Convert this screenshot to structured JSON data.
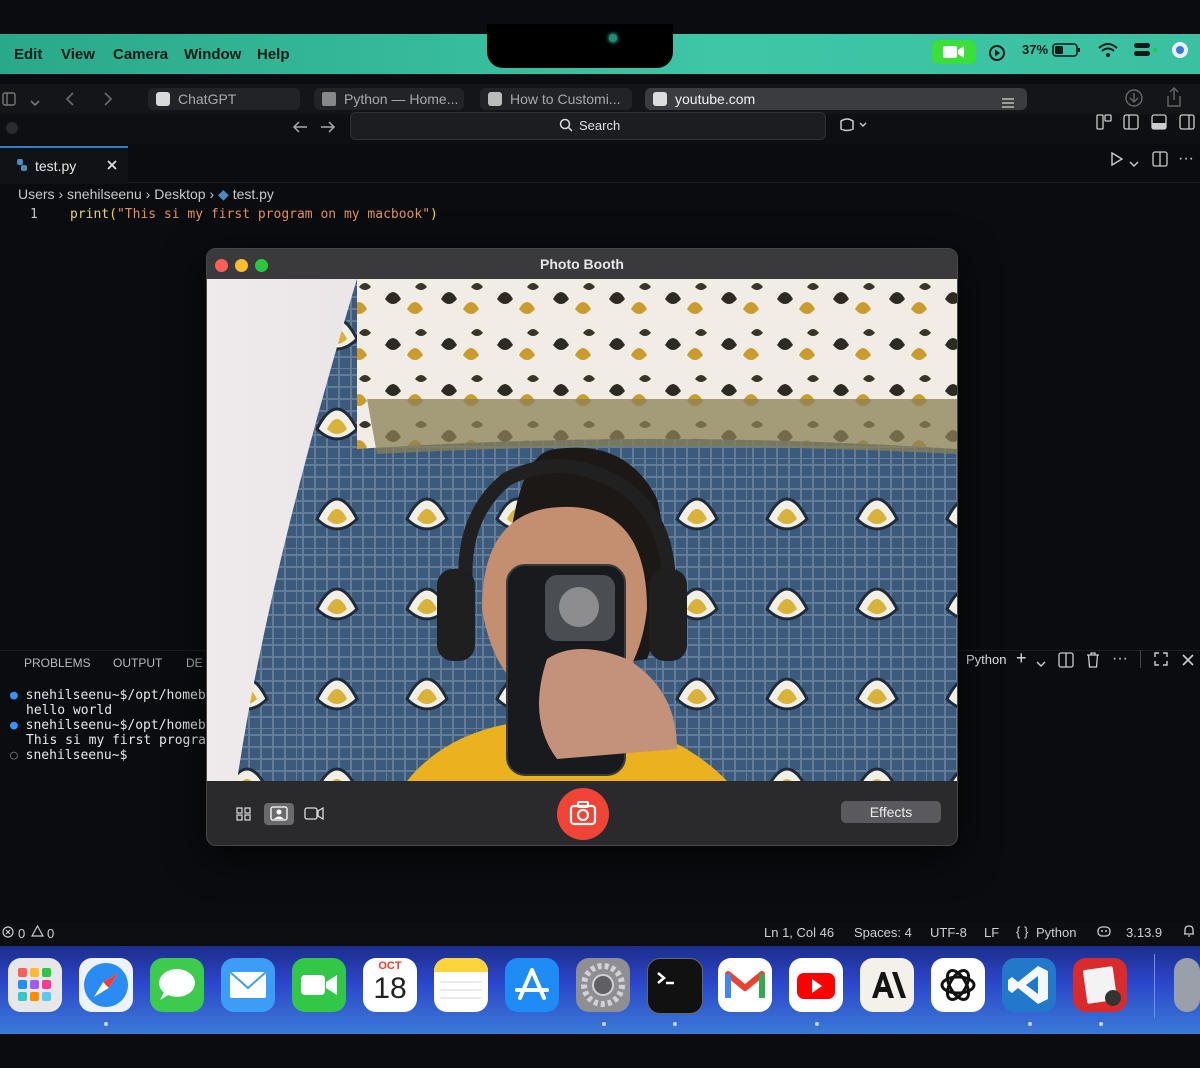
{
  "menubar": {
    "items": [
      "Edit",
      "View",
      "Camera",
      "Window",
      "Help"
    ],
    "battery": "37%"
  },
  "safari": {
    "tabs": [
      "ChatGPT",
      "Python — Home...",
      "How to Customi...",
      "youtube.com"
    ],
    "search_placeholder": "Search"
  },
  "editor": {
    "tab_title": "test.py",
    "breadcrumb": [
      "Users",
      "snehilseenu",
      "Desktop",
      "test.py"
    ],
    "line_number": "1",
    "code_fn": "print",
    "code_open": "(",
    "code_string": "\"This si my first program on my macbook\"",
    "code_close": ")"
  },
  "panel": {
    "tabs": [
      "PROBLEMS",
      "OUTPUT",
      "DE"
    ],
    "terminal_profile": "Python",
    "terminal_lines": [
      "snehilseenu~$/opt/homebre",
      "hello world",
      "snehilseenu~$/opt/homebre",
      "This si my first program",
      "snehilseenu~$"
    ]
  },
  "statusbar": {
    "errors": "0",
    "warnings": "0",
    "position": "Ln 1, Col 46",
    "spaces": "Spaces: 4",
    "encoding": "UTF-8",
    "eol": "LF",
    "language": "Python",
    "version": "3.13.9"
  },
  "photobooth": {
    "title": "Photo Booth",
    "effects_label": "Effects"
  },
  "dock": {
    "calendar_month": "OCT",
    "calendar_day": "18",
    "apps": [
      "launchpad",
      "safari",
      "messages",
      "mail",
      "facetime",
      "calendar",
      "notes",
      "app-store",
      "system-settings",
      "terminal",
      "gmail",
      "youtube",
      "anthropic",
      "chatgpt",
      "vscode",
      "photo-booth"
    ],
    "colors": {
      "accent": "#f04437",
      "menubar": "#3ec6a7",
      "dock": "#2b45c9"
    }
  }
}
